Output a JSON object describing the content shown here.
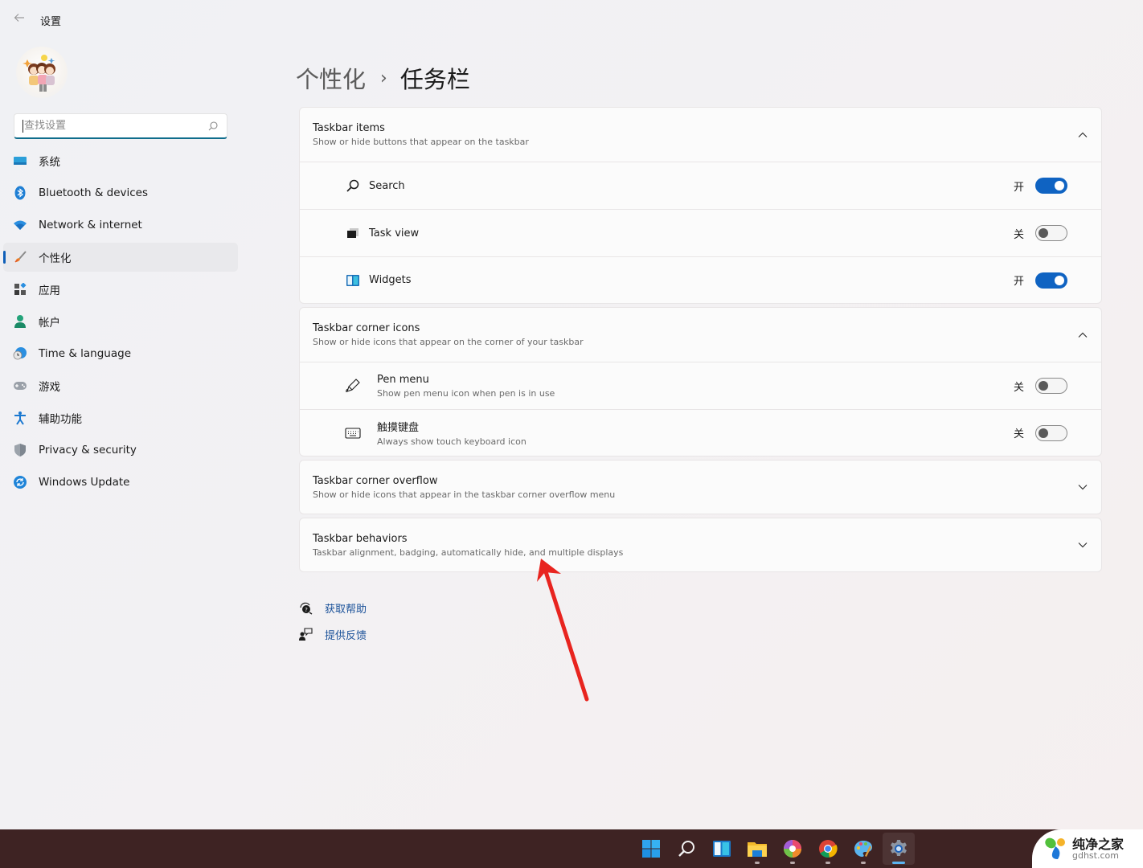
{
  "window": {
    "title": "设置",
    "back_icon": "back-arrow-icon"
  },
  "search": {
    "placeholder": "查找设置",
    "value": "",
    "icon": "search-icon"
  },
  "sidebar": {
    "items": [
      {
        "label": "系统",
        "icon": "system-display-icon",
        "active": false
      },
      {
        "label": "Bluetooth & devices",
        "icon": "bluetooth-icon",
        "active": false
      },
      {
        "label": "Network & internet",
        "icon": "wifi-icon",
        "active": false
      },
      {
        "label": "个性化",
        "icon": "paintbrush-icon",
        "active": true
      },
      {
        "label": "应用",
        "icon": "apps-icon",
        "active": false
      },
      {
        "label": "帐户",
        "icon": "account-icon",
        "active": false
      },
      {
        "label": "Time & language",
        "icon": "clock-globe-icon",
        "active": false
      },
      {
        "label": "游戏",
        "icon": "gamepad-icon",
        "active": false
      },
      {
        "label": "辅助功能",
        "icon": "accessibility-icon",
        "active": false
      },
      {
        "label": "Privacy & security",
        "icon": "shield-icon",
        "active": false
      },
      {
        "label": "Windows Update",
        "icon": "update-sync-icon",
        "active": false
      }
    ]
  },
  "breadcrumb": {
    "parent": "个性化",
    "separator": "›",
    "current": "任务栏"
  },
  "sections": [
    {
      "title": "Taskbar items",
      "subtitle": "Show or hide buttons that appear on the taskbar",
      "expanded": true,
      "rows": [
        {
          "label": "Search",
          "icon": "search-icon",
          "state_label": "开",
          "on": true
        },
        {
          "label": "Task view",
          "icon": "task-view-icon",
          "state_label": "关",
          "on": false
        },
        {
          "label": "Widgets",
          "icon": "widgets-icon",
          "state_label": "开",
          "on": true
        }
      ]
    },
    {
      "title": "Taskbar corner icons",
      "subtitle": "Show or hide icons that appear on the corner of your taskbar",
      "expanded": true,
      "rows": [
        {
          "label": "Pen menu",
          "sub": "Show pen menu icon when pen is in use",
          "icon": "pen-icon",
          "state_label": "关",
          "on": false
        },
        {
          "label": "触摸键盘",
          "sub": "Always show touch keyboard icon",
          "icon": "keyboard-icon",
          "state_label": "关",
          "on": false
        }
      ]
    },
    {
      "title": "Taskbar corner overflow",
      "subtitle": "Show or hide icons that appear in the taskbar corner overflow menu",
      "expanded": false
    },
    {
      "title": "Taskbar behaviors",
      "subtitle": "Taskbar alignment, badging, automatically hide, and multiple displays",
      "expanded": false
    }
  ],
  "links": [
    {
      "label": "获取帮助",
      "icon": "help-icon"
    },
    {
      "label": "提供反馈",
      "icon": "feedback-icon"
    }
  ],
  "annotation": {
    "type": "red-arrow",
    "points_to": "Taskbar behaviors",
    "color": "#e8241f"
  },
  "taskbar": {
    "apps": [
      {
        "name": "start",
        "icon": "windows-start-icon",
        "running": false,
        "active": false
      },
      {
        "name": "search",
        "icon": "search-icon",
        "running": false,
        "active": false
      },
      {
        "name": "widgets",
        "icon": "widgets-icon",
        "running": false,
        "active": false
      },
      {
        "name": "file-explorer",
        "icon": "folder-icon",
        "running": true,
        "active": false
      },
      {
        "name": "photos",
        "icon": "pinwheel-icon",
        "running": true,
        "active": false
      },
      {
        "name": "chrome",
        "icon": "chrome-icon",
        "running": true,
        "active": false
      },
      {
        "name": "paint",
        "icon": "palette-icon",
        "running": true,
        "active": false
      },
      {
        "name": "settings",
        "icon": "gear-icon",
        "running": true,
        "active": true
      }
    ]
  },
  "watermark": {
    "name": "纯净之家",
    "domain": "gdhst.com"
  },
  "colors": {
    "accent": "#0f63c2",
    "link": "#1a5199",
    "taskbar_bg": "#3e2323",
    "arrow": "#e8241f"
  }
}
